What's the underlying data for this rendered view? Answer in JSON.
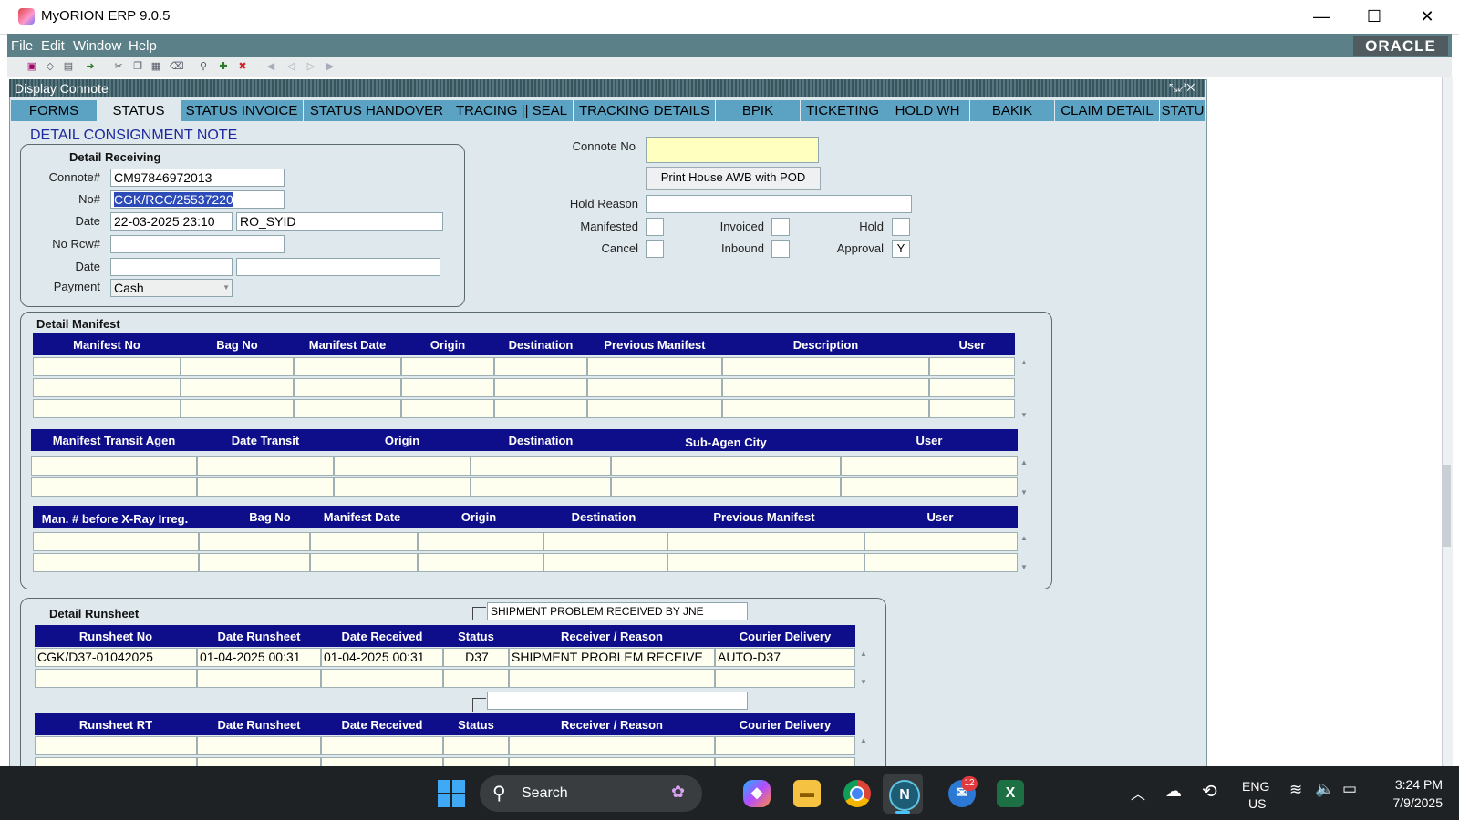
{
  "window": {
    "title": "MyORION ERP 9.0.5",
    "minimize": "—",
    "maximize": "☐",
    "close": "✕"
  },
  "menu": {
    "items": [
      "File",
      "Edit",
      "Window",
      "Help"
    ],
    "brand": "ORACLE"
  },
  "form": {
    "title": "Display Connote",
    "controls": "⤡⤢✕"
  },
  "tabs": [
    "FORMS",
    "STATUS",
    "STATUS INVOICE",
    "STATUS HANDOVER",
    "TRACING || SEAL",
    "TRACKING DETAILS",
    "BPIK",
    "TICKETING",
    "HOLD WH",
    "BAKIK",
    "CLAIM DETAIL",
    "STATU"
  ],
  "active_tab": "STATUS",
  "section_title": "DETAIL CONSIGNMENT NOTE",
  "receiving": {
    "title": "Detail Receiving",
    "connote_label": "Connote#",
    "connote_value": "CM97846972013",
    "no_label": "No#",
    "no_value": "CGK/RCC/25537220",
    "date_label": "Date",
    "date_value": "22-03-2025 23:10",
    "user_value": "RO_SYID",
    "norcw_label": "No Rcw#",
    "norcw_value": "",
    "date2_label": "Date",
    "payment_label": "Payment",
    "payment_value": "Cash"
  },
  "status_panel": {
    "connote_no_label": "Connote No",
    "connote_no_value": "",
    "print_button": "Print House AWB with POD",
    "hold_reason_label": "Hold Reason",
    "manifested_label": "Manifested",
    "invoiced_label": "Invoiced",
    "hold_label": "Hold",
    "cancel_label": "Cancel",
    "inbound_label": "Inbound",
    "approval_label": "Approval",
    "approval_value": "Y"
  },
  "manifest": {
    "title": "Detail Manifest",
    "table1_headers": [
      "Manifest No",
      "Bag No",
      "Manifest Date",
      "Origin",
      "Destination",
      "Previous Manifest",
      "Description",
      "User"
    ],
    "table2_headers": [
      "Manifest Transit Agen",
      "Date Transit",
      "Origin",
      "Destination",
      "Sub-Agen City",
      "User"
    ],
    "table3_headers": [
      "Man. # before X-Ray Irreg.",
      "Bag No",
      "Manifest Date",
      "Origin",
      "Destination",
      "Previous Manifest",
      "User"
    ]
  },
  "runsheet": {
    "title": "Detail Runsheet",
    "reason_display": "SHIPMENT PROBLEM RECEIVED BY JNE",
    "headers": [
      "Runsheet No",
      "Date Runsheet",
      "Date Received",
      "Status",
      "Receiver / Reason",
      "Courier Delivery"
    ],
    "rows": [
      [
        "CGK/D37-01042025",
        "01-04-2025 00:31",
        "01-04-2025 00:31",
        "D37",
        "SHIPMENT PROBLEM RECEIVE",
        "AUTO-D37"
      ]
    ],
    "rt_headers": [
      "Runsheet RT",
      "Date Runsheet",
      "Date Received",
      "Status",
      "Receiver / Reason",
      "Courier Delivery"
    ]
  },
  "taskbar": {
    "search_placeholder": "Search",
    "lang": "ENG",
    "region": "US",
    "time": "3:24 PM",
    "date": "7/9/2025",
    "badge": "12"
  }
}
